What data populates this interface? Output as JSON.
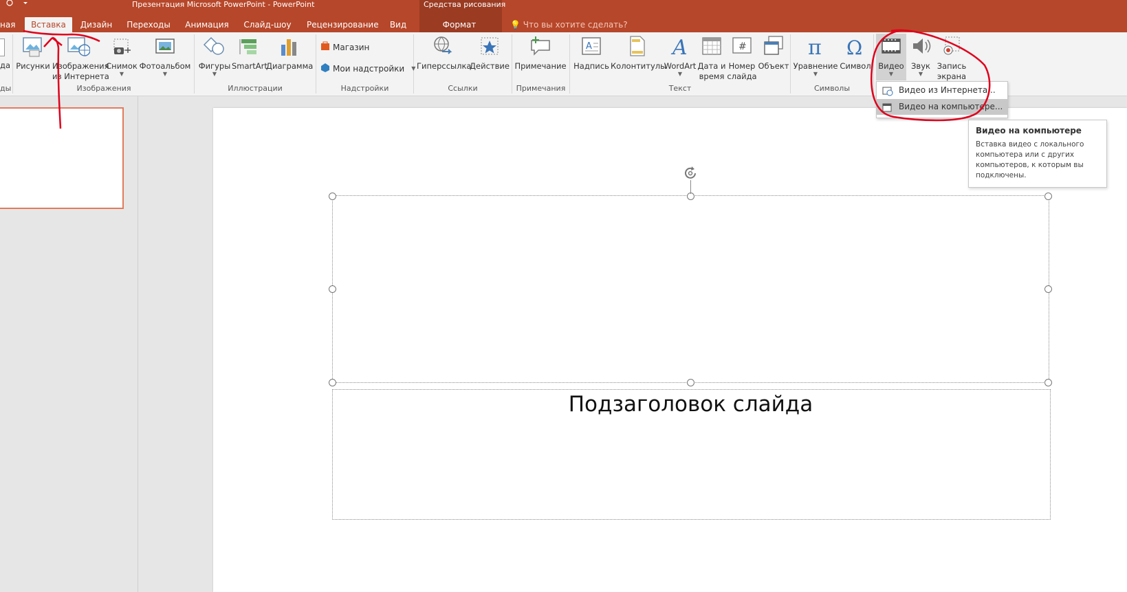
{
  "app": {
    "title": "Презентация Microsoft PowerPoint - PowerPoint",
    "context_group": "Средства рисования",
    "search_placeholder": "Что вы хотите сделать?"
  },
  "tabs": [
    {
      "label": "ная",
      "active": false
    },
    {
      "label": "Вставка",
      "active": true
    },
    {
      "label": "Дизайн",
      "active": false
    },
    {
      "label": "Переходы",
      "active": false
    },
    {
      "label": "Анимация",
      "active": false
    },
    {
      "label": "Слайд-шоу",
      "active": false
    },
    {
      "label": "Рецензирование",
      "active": false
    },
    {
      "label": "Вид",
      "active": false
    },
    {
      "label": "Формат",
      "active": false
    }
  ],
  "ribbon": {
    "buttons": {
      "pictures": "Рисунки",
      "online_images_1": "Изображения",
      "online_images_2": "из Интернета",
      "screenshot": "Снимок",
      "photo_album": "Фотоальбом",
      "shapes": "Фигуры",
      "smartart": "SmartArt",
      "chart": "Диаграмма",
      "store": "Магазин",
      "my_addins": "Мои надстройки",
      "hyperlink": "Гиперссылка",
      "action": "Действие",
      "comment": "Примечание",
      "textbox": "Надпись",
      "header_footer": "Колонтитулы",
      "wordart": "WordArt",
      "datetime_1": "Дата и",
      "datetime_2": "время",
      "slide_number_1": "Номер",
      "slide_number_2": "слайда",
      "object": "Объект",
      "equation": "Уравнение",
      "symbol": "Символ",
      "video": "Видео",
      "audio": "Звук",
      "screen_rec_1": "Запись",
      "screen_rec_2": "экрана"
    },
    "groups": {
      "slides": "ды",
      "images": "Изображения",
      "illustrations": "Иллюстрации",
      "addins": "Надстройки",
      "links": "Ссылки",
      "comments": "Примечания",
      "text": "Текст",
      "symbols": "Символы"
    }
  },
  "video_menu": {
    "items": [
      {
        "label": "Видео из Интернета..."
      },
      {
        "label": "Видео на компьютере..."
      }
    ]
  },
  "tooltip": {
    "title": "Видео на компьютере",
    "body": "Вставка видео с локального компьютера или с других компьютеров, к которым вы подключены."
  },
  "slide": {
    "subtitle": "Подзаголовок слайда"
  },
  "colors": {
    "accent": "#b7472a",
    "annotation": "#e0001b"
  }
}
